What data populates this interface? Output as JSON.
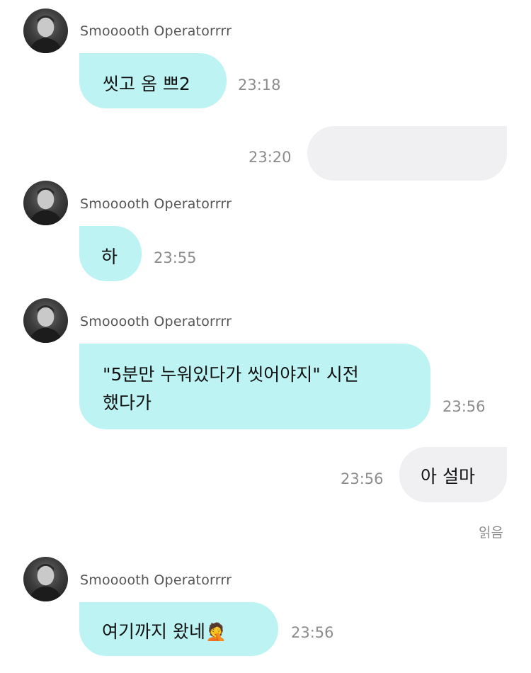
{
  "theme": {
    "incoming_bubble_color": "#bdf3f3",
    "outgoing_bubble_color": "#f0f0f3",
    "meta_text_color": "#8c8c8c"
  },
  "messages": [
    {
      "direction": "incoming",
      "sender": "Smooooth Operatorrrr",
      "avatar": "avatar-photo",
      "text": "씻고 옴 쁘2",
      "time": "23:18"
    },
    {
      "direction": "outgoing",
      "text": "",
      "time": "23:20"
    },
    {
      "direction": "incoming",
      "sender": "Smooooth Operatorrrr",
      "avatar": "avatar-photo",
      "text": "하",
      "time": "23:55"
    },
    {
      "direction": "incoming",
      "sender": "Smooooth Operatorrrr",
      "avatar": "avatar-photo",
      "text_lines": [
        "\"5분만 누워있다가 씻어야지\" 시전",
        "했다가"
      ],
      "time": "23:56"
    },
    {
      "direction": "outgoing",
      "text": "아 설마",
      "time": "23:56",
      "status": "읽음"
    },
    {
      "direction": "incoming",
      "sender": "Smooooth Operatorrrr",
      "avatar": "avatar-photo",
      "text": "여기까지 왔네",
      "emoji": "🤦",
      "emoji_icon": "facepalm-emoji-icon",
      "time": "23:56"
    }
  ]
}
